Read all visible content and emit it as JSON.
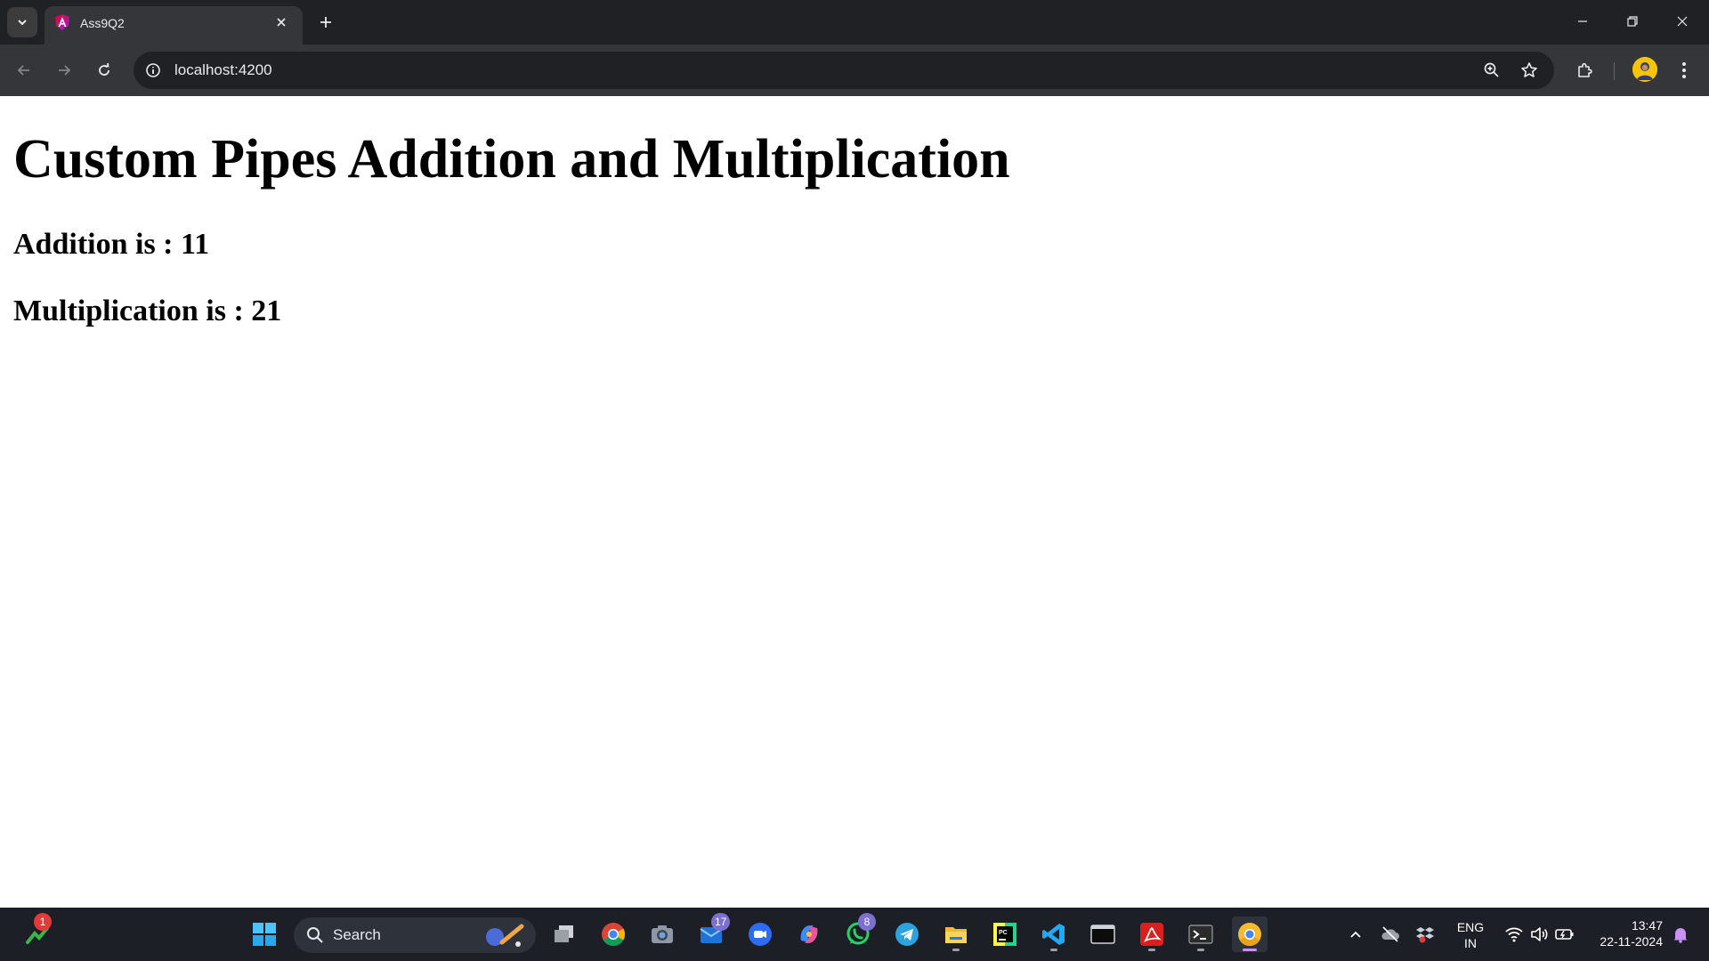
{
  "browser": {
    "tab": {
      "title": "Ass9Q2",
      "favicon": "angular-logo-icon"
    },
    "url": "localhost:4200"
  },
  "page": {
    "heading": "Custom Pipes Addition and Multiplication",
    "addition": "Addition is : 11",
    "multiplication": "Multiplication is : 21"
  },
  "taskbar": {
    "search_label": "Search",
    "apps": [
      {
        "name": "stocks-widget-icon",
        "badge": "1"
      },
      {
        "name": "windows-start-icon"
      },
      {
        "name": "task-view-icon"
      },
      {
        "name": "chrome-icon"
      },
      {
        "name": "camera-icon"
      },
      {
        "name": "mail-icon",
        "badge": "17"
      },
      {
        "name": "zoom-icon"
      },
      {
        "name": "copilot-icon"
      },
      {
        "name": "whatsapp-icon",
        "badge": "8"
      },
      {
        "name": "telegram-icon"
      },
      {
        "name": "file-explorer-icon"
      },
      {
        "name": "pycharm-icon"
      },
      {
        "name": "vscode-icon"
      },
      {
        "name": "terminal-icon"
      },
      {
        "name": "acrobat-icon"
      },
      {
        "name": "powershell-icon"
      },
      {
        "name": "chrome-canary-icon"
      }
    ],
    "tray": {
      "language_line1": "ENG",
      "language_line2": "IN",
      "time": "13:47",
      "date": "22-11-2024"
    }
  },
  "colors": {
    "chrome_dark": "#202124",
    "chrome_toolbar": "#35363a",
    "taskbar": "#1c1f26",
    "badge": "#7d6fd1"
  }
}
